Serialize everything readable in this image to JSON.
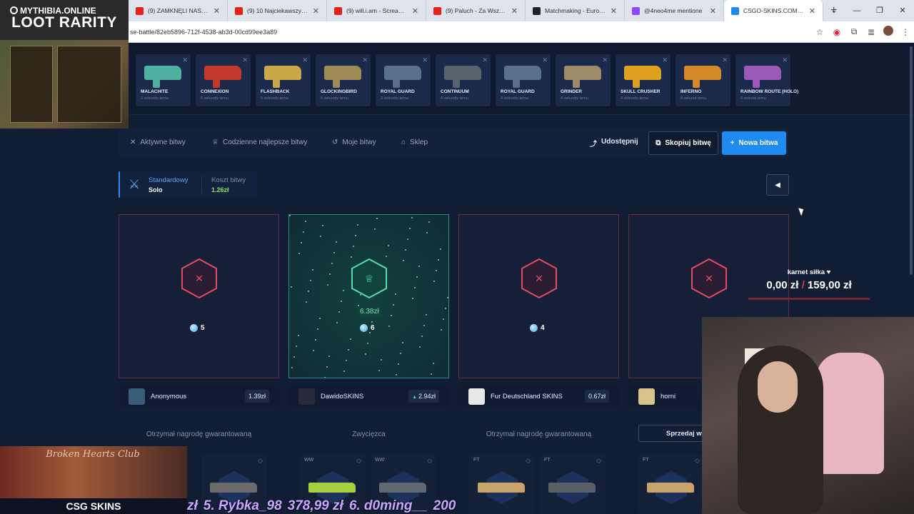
{
  "browser": {
    "tabs": [
      {
        "title": "(9) ZAMKNĘLI NAS W AU",
        "color": "#e62117"
      },
      {
        "title": "(9) 10 Najciekawszych Ne",
        "color": "#e62117"
      },
      {
        "title": "(9) will.i.am - Scream & Sh",
        "color": "#e62117"
      },
      {
        "title": "(9) Paluch - Za Wszyst",
        "color": "#e62117"
      },
      {
        "title": "Matchmaking - Europe Si",
        "color": "#222222"
      },
      {
        "title": "@4neo4me mentione",
        "color": "#9146ff"
      },
      {
        "title": "CSGO-SKINS.COM - Najle",
        "color": "#1f8af0"
      }
    ],
    "url": "se-battle/82eb5896-712f-4538-ab3d-00cd99ee3a89"
  },
  "overlay": {
    "brand": "MYTHIBIA.ONLINE",
    "title": "LOOT RARITY",
    "club": "Broken Hearts Club",
    "site": "CSG SKINS",
    "ticker": [
      "zł",
      "5. Rybka_98",
      "378,99 zł",
      "6. d0ming__",
      "200"
    ]
  },
  "case_items": [
    {
      "name": "MALACHITE",
      "sub": "2 sekundy temu",
      "color": "#4fb0a0"
    },
    {
      "name": "CONNEXION",
      "sub": "5 sekundy temu",
      "color": "#c0392b"
    },
    {
      "name": "FLASHBACK",
      "sub": "5 sekundy temu",
      "color": "#c9a84a"
    },
    {
      "name": "GLOCKINGBIRD",
      "sub": "5 sekundy temu",
      "color": "#a08a58"
    },
    {
      "name": "ROYAL GUARD",
      "sub": "3 sekundy temu",
      "color": "#5a6f8a"
    },
    {
      "name": "CONTINUUM",
      "sub": "4 sekundy temu",
      "color": "#59636e"
    },
    {
      "name": "ROYAL GUARD",
      "sub": "4 sekundy temu",
      "color": "#5a6f8a"
    },
    {
      "name": "GRINDER",
      "sub": "4 sekundy temu",
      "color": "#9c8b66"
    },
    {
      "name": "SKULL CRUSHER",
      "sub": "4 sekundy temu",
      "color": "#e0a020"
    },
    {
      "name": "INFERNO",
      "sub": "8 sekund temu",
      "color": "#d48a2a"
    },
    {
      "name": "RAINBOW ROUTE (HOLO)",
      "sub": "9 sekund temu",
      "color": "#9b59b6"
    }
  ],
  "nav": {
    "active_battles": "Aktywne bitwy",
    "daily_best": "Codzienne najlepsze bitwy",
    "my_battles": "Moje bitwy",
    "shop": "Sklep",
    "share": "Udostępnij",
    "copy": "Skopiuj bitwę",
    "new": "Nowa bitwa"
  },
  "mode": {
    "label": "Standardowy",
    "value": "Solo",
    "cost_label": "Koszt bitwy",
    "cost_value": "1.26zł"
  },
  "players": [
    {
      "gems": "5",
      "name": "Anonymous",
      "amount": "1.39zł",
      "label": "Otrzymał nagrodę gwarantowaną",
      "winner": false
    },
    {
      "gems": "6",
      "name": "DawidoSKINS",
      "amount": "2.94zł",
      "label": "Zwycięzca",
      "winner": true,
      "win_value": "6.38zł"
    },
    {
      "gems": "4",
      "name": "Fur Deutschland SKINS",
      "amount": "0.67zł",
      "label": "Otrzymał nagrodę gwarantowaną",
      "winner": false
    },
    {
      "gems": "",
      "name": "horni",
      "amount": "",
      "label": "",
      "winner": false
    }
  ],
  "sell_button": "Sprzedaj ws",
  "drops": [
    {
      "quality": "",
      "color": "#6b6b6b"
    },
    {
      "quality": "WW",
      "color": "#a7cf3e"
    },
    {
      "quality": "WW",
      "color": "#606870"
    },
    {
      "quality": "FT",
      "color": "#c8a36a"
    },
    {
      "quality": "FT",
      "color": "#5a6066"
    },
    {
      "quality": "FT",
      "color": "#c8a36a"
    }
  ],
  "donation": {
    "title": "karnet siłka ♥",
    "amount": "0,00 zł",
    "target": "159,00 zł"
  }
}
